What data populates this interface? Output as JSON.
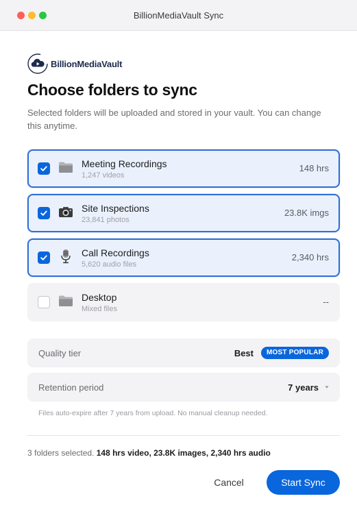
{
  "window": {
    "title": "BillionMediaVault Sync"
  },
  "brand": {
    "name": "BillionMediaVault",
    "logo_icon": "cloud-play-icon",
    "accent_color": "#0a66dc",
    "navy_color": "#1d2a4d"
  },
  "header": {
    "title": "Choose folders to sync",
    "subtitle": "Selected folders will be uploaded and stored in your vault. You can change this anytime."
  },
  "folders": [
    {
      "name": "Meeting Recordings",
      "meta": "1,247 videos",
      "size": "148 hrs",
      "checked": true,
      "icon": "folder-icon"
    },
    {
      "name": "Site Inspections",
      "meta": "23,841 photos",
      "size": "23.8K imgs",
      "checked": true,
      "icon": "camera-icon"
    },
    {
      "name": "Call Recordings",
      "meta": "5,620 audio files",
      "size": "2,340 hrs",
      "checked": true,
      "icon": "microphone-icon"
    },
    {
      "name": "Desktop",
      "meta": "Mixed files",
      "size": "--",
      "checked": false,
      "icon": "folder-icon"
    }
  ],
  "settings": {
    "quality": {
      "label": "Quality tier",
      "value": "Best",
      "badge": "MOST POPULAR"
    },
    "retention": {
      "label": "Retention period",
      "value": "7 years",
      "caret_icon": "chevron-down-icon"
    },
    "note": "Files auto-expire after 7 years from upload. No manual cleanup needed."
  },
  "summary": {
    "prefix": "3 folders selected.",
    "details": "148 hrs video, 23.8K images, 2,340 hrs audio"
  },
  "actions": {
    "cancel_label": "Cancel",
    "start_label": "Start Sync"
  }
}
